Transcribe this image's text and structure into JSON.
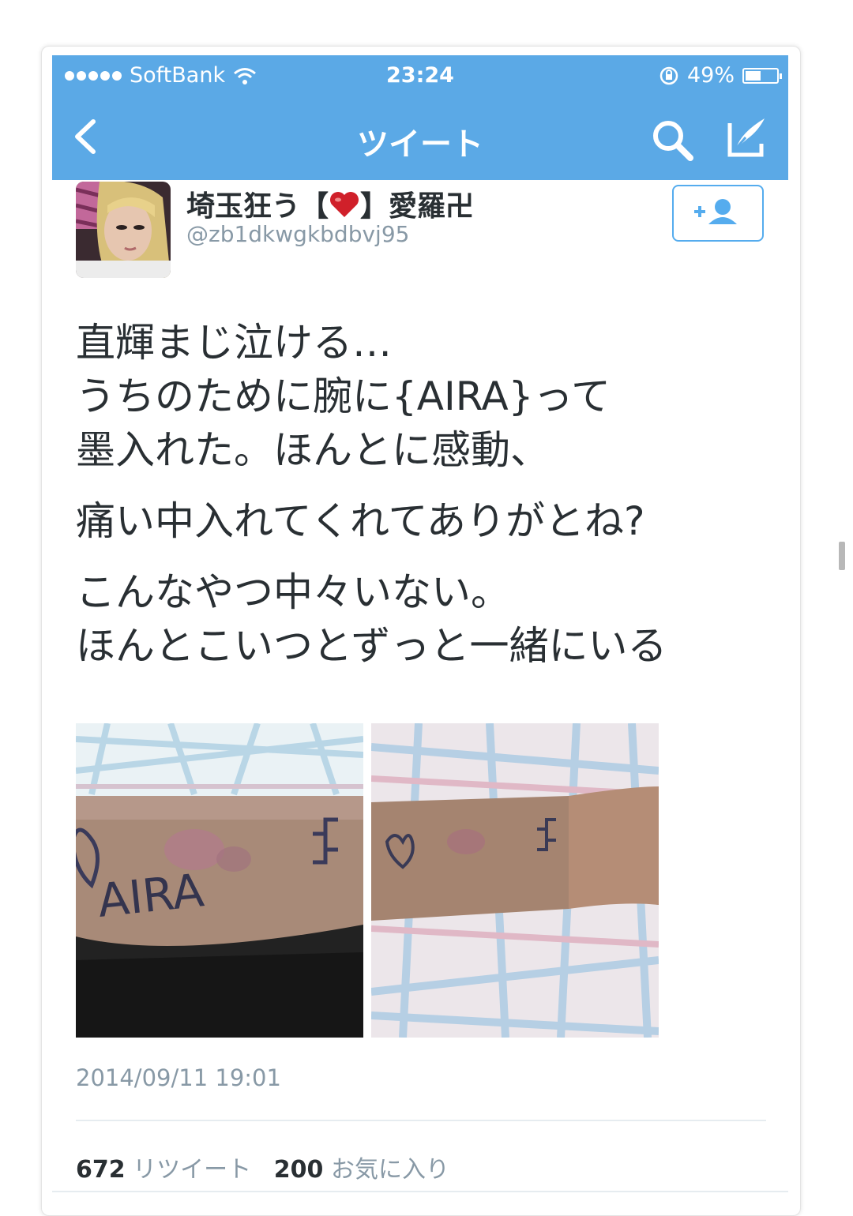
{
  "status_bar": {
    "carrier": "SoftBank",
    "time": "23:24",
    "battery": "49%",
    "battery_level": 0.49
  },
  "nav": {
    "title": "ツイート"
  },
  "user": {
    "name_prefix": "埼玉狂う【",
    "name_suffix": "】愛羅卍",
    "handle": "@zb1dkwgkbdbvj95"
  },
  "tweet": {
    "lines": [
      "直輝まじ泣ける…",
      "うちのために腕に{AIRA}って",
      "墨入れた。ほんとに感動、",
      "痛い中入れてくれてありがとね?",
      "こんなやつ中々いない。",
      "ほんとこいつとずっと一緒にいる"
    ],
    "photo_text": "AIRA",
    "timestamp": "2014/09/11 19:01"
  },
  "stats": {
    "retweet_count": "672",
    "retweet_label": "リツイート",
    "favorite_count": "200",
    "favorite_label": "お気に入り"
  },
  "colors": {
    "header": "#5ba9e6",
    "accent": "#55acee",
    "text": "#292f33",
    "muted": "#8899a6"
  }
}
